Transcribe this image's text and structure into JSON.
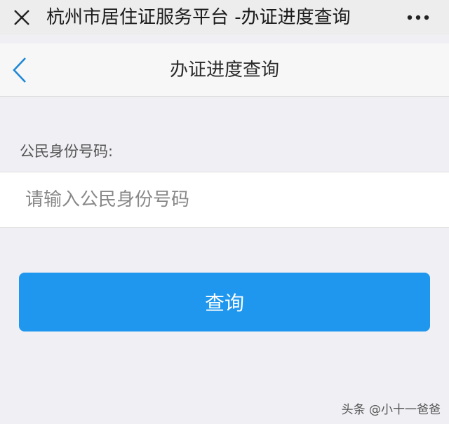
{
  "window": {
    "title": "杭州市居住证服务平台 -办证进度查询",
    "close_icon": "close-icon",
    "more_icon": "more-dots-icon"
  },
  "navbar": {
    "title": "办证进度查询",
    "back_icon": "chevron-left-icon"
  },
  "form": {
    "id_label": "公民身份号码:",
    "id_placeholder": "请输入公民身份号码",
    "id_value": "",
    "submit_label": "查询"
  },
  "watermark": {
    "text": "头条 @小十一爸爸"
  },
  "colors": {
    "accent": "#1f97ee",
    "back_icon": "#1e88d6",
    "background": "#efeff4"
  }
}
